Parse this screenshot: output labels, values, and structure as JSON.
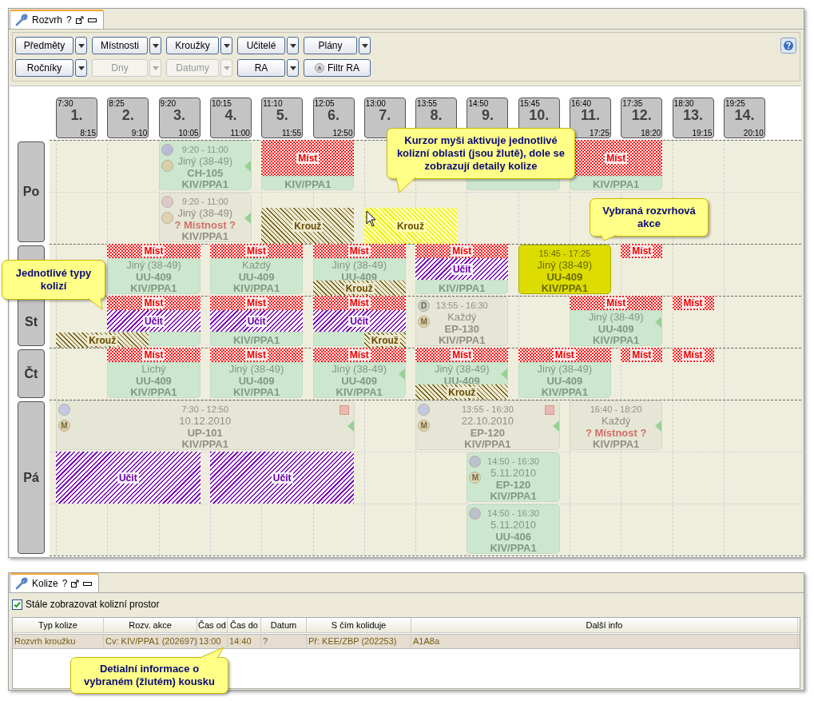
{
  "main_tab": {
    "title": "Rozvrh",
    "help": "?"
  },
  "toolbar": {
    "rows": [
      [
        {
          "label": "Předměty",
          "kind": "split",
          "disabled": false
        },
        {
          "label": "Místnosti",
          "kind": "split",
          "disabled": false
        },
        {
          "label": "Kroužky",
          "kind": "split",
          "disabled": false
        },
        {
          "label": "Učitelé",
          "kind": "split",
          "disabled": false
        },
        {
          "label": "Plány",
          "kind": "split",
          "disabled": false
        }
      ],
      [
        {
          "label": "Ročníky",
          "kind": "split",
          "disabled": false
        },
        {
          "label": "Dny",
          "kind": "split",
          "disabled": true
        },
        {
          "label": "Datumy",
          "kind": "split",
          "disabled": true
        },
        {
          "label": "RA",
          "kind": "split",
          "disabled": false
        },
        {
          "label": "Filtr RA",
          "kind": "button",
          "disabled": false
        }
      ]
    ]
  },
  "periods": [
    {
      "start": "7:30",
      "number": "1.",
      "end": "8:15"
    },
    {
      "start": "8:25",
      "number": "2.",
      "end": "9:10"
    },
    {
      "start": "9:20",
      "number": "3.",
      "end": "10:05"
    },
    {
      "start": "10:15",
      "number": "4.",
      "end": "11:00"
    },
    {
      "start": "11:10",
      "number": "5.",
      "end": "11:55"
    },
    {
      "start": "12:05",
      "number": "6.",
      "end": "12:50"
    },
    {
      "start": "13:00",
      "number": "7."
    },
    {
      "start": "13:55",
      "number": "8."
    },
    {
      "start": "14:50",
      "number": "9."
    },
    {
      "start": "15:45",
      "number": "10."
    },
    {
      "start": "16:40",
      "number": "11.",
      "end": "17:25"
    },
    {
      "start": "17:35",
      "number": "12.",
      "end": "18:20"
    },
    {
      "start": "18:30",
      "number": "13.",
      "end": "19:15"
    },
    {
      "start": "19:25",
      "number": "14.",
      "end": "20:10"
    }
  ],
  "days": [
    {
      "label": "Po",
      "lanes": [
        {
          "cards": [
            {
              "kind": "empty"
            },
            {
              "kind": "empty"
            },
            {
              "kind": "event",
              "selected": false,
              "inactive": false,
              "arrow": true,
              "flag": false,
              "badges": [
                {
                  "color": "#b8bcd8"
                },
                {
                  "color": "#d8d0a8"
                }
              ],
              "time": "9:20 - 11:00",
              "info": "Jiný (38-49)",
              "room": "CH-105",
              "course": "KIV/PPA1"
            },
            {
              "kind": "more"
            },
            {
              "kind": "event",
              "selected": false,
              "inactive": false,
              "arrow": false,
              "flag": false,
              "course": "KIV/PPA1"
            },
            {
              "kind": "more"
            },
            {
              "kind": "empty"
            },
            {
              "kind": "empty"
            },
            {
              "kind": "event",
              "selected": false,
              "inactive": false,
              "arrow": false,
              "flag": false
            },
            {
              "kind": "more"
            },
            {
              "kind": "event",
              "selected": false,
              "inactive": false,
              "arrow": false,
              "flag": false,
              "course": "KIV/PPA1"
            },
            {
              "kind": "more"
            }
          ],
          "upper": [
            {
              "kind": "empty"
            },
            {
              "kind": "empty"
            },
            {
              "kind": "empty"
            },
            {
              "kind": "empty"
            },
            {
              "kind": "mist",
              "label": "Míst",
              "active": false
            },
            {
              "kind": "more"
            },
            {
              "kind": "empty"
            },
            {
              "kind": "empty"
            },
            {
              "kind": "empty"
            },
            {
              "kind": "empty"
            },
            {
              "kind": "mist",
              "label": "Míst",
              "active": false
            },
            {
              "kind": "more"
            }
          ]
        },
        {
          "cards": [
            {
              "kind": "empty"
            },
            {
              "kind": "empty"
            },
            {
              "kind": "event",
              "selected": false,
              "inactive": true,
              "arrow": true,
              "flag": false,
              "badges": [
                {
                  "color": "#e0c8c8"
                },
                {
                  "color": "#e0d4b0"
                }
              ],
              "time": "9:20 - 11:00",
              "info": "Jiný (38-49)",
              "room": "? Místnost ?",
              "room_missing": true,
              "course": "KIV/PPA1"
            },
            {
              "kind": "more"
            }
          ],
          "lower": [
            {
              "kind": "empty"
            },
            {
              "kind": "empty"
            },
            {
              "kind": "empty"
            },
            {
              "kind": "empty"
            },
            {
              "kind": "krouz",
              "label": "Krouž",
              "active": false
            },
            {
              "kind": "more"
            },
            {
              "kind": "krouz",
              "label": "Krouž",
              "active": true
            },
            {
              "kind": "more"
            }
          ]
        }
      ]
    },
    {
      "lanes": [
        {
          "cards": [
            {
              "kind": "empty"
            },
            {
              "kind": "event",
              "selected": false,
              "inactive": false,
              "arrow": false,
              "flag": false,
              "info": "Jiný (38-49)",
              "room": "UU-409",
              "course": "KIV/PPA1"
            },
            {
              "kind": "more"
            },
            {
              "kind": "event",
              "selected": false,
              "inactive": false,
              "arrow": false,
              "flag": false,
              "info": "Každý",
              "room": "UU-409",
              "course": "KIV/PPA1"
            },
            {
              "kind": "more"
            },
            {
              "kind": "event",
              "selected": false,
              "inactive": false,
              "arrow": false,
              "flag": false,
              "info": "Jiný (38-49)",
              "room": "UU-409"
            },
            {
              "kind": "more"
            },
            {
              "kind": "event",
              "selected": false,
              "inactive": false,
              "arrow": false,
              "flag": false,
              "course": "KIV/PPA1"
            },
            {
              "kind": "more"
            },
            {
              "kind": "event",
              "selected": true,
              "inactive": false,
              "arrow": false,
              "flag": false,
              "time": "15:45 - 17:25",
              "info": "Jiný (38-49)",
              "room": "UU-409",
              "course": "KIV/PPA1"
            },
            {
              "kind": "more"
            }
          ],
          "top": [
            {
              "kind": "empty"
            },
            {
              "kind": "mist",
              "label": "Míst",
              "active": false
            },
            {
              "kind": "more"
            },
            {
              "kind": "mist",
              "label": "Míst",
              "active": false
            },
            {
              "kind": "more"
            },
            {
              "kind": "mist",
              "label": "Míst",
              "active": false
            },
            {
              "kind": "more"
            },
            {
              "kind": "mist",
              "label": "Míst",
              "active": false
            },
            {
              "kind": "more"
            },
            {
              "kind": "empty"
            },
            {
              "kind": "empty"
            },
            {
              "kind": "mist",
              "label": "Míst",
              "active": false
            }
          ],
          "middle": [
            {
              "kind": "empty"
            },
            {
              "kind": "empty"
            },
            {
              "kind": "empty"
            },
            {
              "kind": "empty"
            },
            {
              "kind": "empty"
            },
            {
              "kind": "empty"
            },
            {
              "kind": "empty"
            },
            {
              "kind": "ucit",
              "label": "Učit",
              "active": false
            },
            {
              "kind": "more"
            }
          ],
          "bottom": [
            {
              "kind": "empty"
            },
            {
              "kind": "empty"
            },
            {
              "kind": "empty"
            },
            {
              "kind": "empty"
            },
            {
              "kind": "empty"
            },
            {
              "kind": "krouz",
              "label": "Krouž",
              "active": false
            },
            {
              "kind": "more"
            }
          ]
        }
      ]
    },
    {
      "label": "St",
      "lanes": [
        {
          "cards": [
            {
              "kind": "empty"
            },
            {
              "kind": "event",
              "selected": false,
              "inactive": false,
              "arrow": false,
              "flag": false
            },
            {
              "kind": "more"
            },
            {
              "kind": "event",
              "selected": false,
              "inactive": false,
              "arrow": false,
              "flag": false,
              "course": "KIV/PPA1"
            },
            {
              "kind": "more"
            },
            {
              "kind": "event",
              "selected": false,
              "inactive": false,
              "arrow": false,
              "flag": false
            },
            {
              "kind": "more"
            },
            {
              "kind": "event",
              "selected": false,
              "inactive": true,
              "arrow": false,
              "flag": false,
              "badges": [
                {
                  "color": "#c8d0c0",
                  "text": "D"
                },
                {
                  "color": "#e8d0a0",
                  "text": "M"
                }
              ],
              "time": "13:55 - 16:30",
              "info": "Každý",
              "room": "EP-130",
              "course": "KIV/PPA1"
            },
            {
              "kind": "more"
            },
            {
              "kind": "empty"
            },
            {
              "kind": "event",
              "selected": false,
              "inactive": false,
              "arrow": true,
              "flag": false,
              "info": "Jiný (38-49)",
              "room": "UU-409",
              "course": "KIV/PPA1"
            },
            {
              "kind": "more"
            }
          ],
          "top": [
            {
              "kind": "empty"
            },
            {
              "kind": "mist",
              "label": "Míst",
              "active": false
            },
            {
              "kind": "more"
            },
            {
              "kind": "mist",
              "label": "Míst",
              "active": false
            },
            {
              "kind": "more"
            },
            {
              "kind": "mist",
              "label": "Míst",
              "active": false
            },
            {
              "kind": "more"
            },
            {
              "kind": "empty"
            },
            {
              "kind": "empty"
            },
            {
              "kind": "empty"
            },
            {
              "kind": "mist",
              "label": "Míst",
              "active": false
            },
            {
              "kind": "more"
            },
            {
              "kind": "mist",
              "label": "Míst",
              "active": false
            }
          ],
          "middle": [
            {
              "kind": "empty"
            },
            {
              "kind": "ucit",
              "label": "Učit",
              "active": false
            },
            {
              "kind": "more"
            },
            {
              "kind": "ucit",
              "label": "Učit",
              "active": false
            },
            {
              "kind": "more"
            },
            {
              "kind": "ucit",
              "label": "Učit",
              "active": false
            },
            {
              "kind": "more"
            }
          ],
          "bottom": [
            {
              "kind": "krouz",
              "label": "Krouž",
              "active": false
            },
            {
              "kind": "more"
            },
            {
              "kind": "empty"
            },
            {
              "kind": "empty"
            },
            {
              "kind": "empty"
            },
            {
              "kind": "empty"
            },
            {
              "kind": "krouz",
              "label": "Krouž",
              "active": false
            }
          ]
        }
      ]
    },
    {
      "label": "Čt",
      "lanes": [
        {
          "cards": [
            {
              "kind": "empty"
            },
            {
              "kind": "event",
              "selected": false,
              "inactive": false,
              "arrow": false,
              "flag": false,
              "info": "Lichý",
              "room": "UU-409",
              "course": "KIV/PPA1"
            },
            {
              "kind": "more"
            },
            {
              "kind": "event",
              "selected": false,
              "inactive": false,
              "arrow": false,
              "flag": false,
              "info": "Jiný (38-49)",
              "room": "UU-409",
              "course": "KIV/PPA1"
            },
            {
              "kind": "more"
            },
            {
              "kind": "event",
              "selected": false,
              "inactive": false,
              "arrow": true,
              "flag": false,
              "info": "Jiný (38-49)",
              "room": "UU-409",
              "course": "KIV/PPA1"
            },
            {
              "kind": "more"
            },
            {
              "kind": "event",
              "selected": false,
              "inactive": false,
              "arrow": true,
              "flag": false,
              "info": "Jiný (38-49)",
              "room": "UU-409"
            },
            {
              "kind": "more"
            },
            {
              "kind": "event",
              "selected": false,
              "inactive": false,
              "arrow": false,
              "flag": false,
              "info": "Jiný (38-49)",
              "room": "UU-409",
              "course": "KIV/PPA1"
            },
            {
              "kind": "more"
            }
          ],
          "top": [
            {
              "kind": "empty"
            },
            {
              "kind": "mist",
              "label": "Míst",
              "active": false
            },
            {
              "kind": "more"
            },
            {
              "kind": "mist",
              "label": "Míst",
              "active": false
            },
            {
              "kind": "more"
            },
            {
              "kind": "mist",
              "label": "Míst",
              "active": false
            },
            {
              "kind": "more"
            },
            {
              "kind": "mist",
              "label": "Míst",
              "active": false
            },
            {
              "kind": "more"
            },
            {
              "kind": "mist",
              "label": "Míst",
              "active": false
            },
            {
              "kind": "more"
            },
            {
              "kind": "mist",
              "label": "Míst",
              "active": false
            },
            {
              "kind": "mist",
              "label": "Míst",
              "active": false
            }
          ],
          "bottom": [
            {
              "kind": "empty"
            },
            {
              "kind": "empty"
            },
            {
              "kind": "empty"
            },
            {
              "kind": "empty"
            },
            {
              "kind": "empty"
            },
            {
              "kind": "empty"
            },
            {
              "kind": "empty"
            },
            {
              "kind": "krouz",
              "label": "Krouž",
              "active": false
            },
            {
              "kind": "more"
            }
          ]
        }
      ]
    },
    {
      "label": "Pá",
      "lanes": [
        {
          "cards": [
            {
              "kind": "event",
              "selected": false,
              "inactive": true,
              "arrow": true,
              "flag": true,
              "badges": [
                {
                  "color": "#c4c8e4"
                },
                {
                  "color": "#e8d0a0",
                  "text": "M"
                }
              ],
              "time": "7:30 - 12:50",
              "info": "10.12.2010",
              "room": "UP-101",
              "course": "KIV/PPA1"
            },
            {
              "kind": "more"
            },
            {
              "kind": "more"
            },
            {
              "kind": "more"
            },
            {
              "kind": "more"
            },
            {
              "kind": "more"
            },
            {
              "kind": "empty"
            },
            {
              "kind": "event",
              "selected": false,
              "inactive": true,
              "arrow": true,
              "flag": true,
              "badges": [
                {
                  "color": "#c4c8e4"
                },
                {
                  "color": "#e8d0a0",
                  "text": "M"
                }
              ],
              "time": "13:55 - 16:30",
              "info": "22.10.2010",
              "room": "EP-120",
              "course": "KIV/PPA1"
            },
            {
              "kind": "more"
            },
            {
              "kind": "more"
            },
            {
              "kind": "event",
              "selected": false,
              "inactive": true,
              "arrow": true,
              "flag": false,
              "time": "16:40 - 18:20",
              "info": "Každý",
              "room": "? Místnost ?",
              "room_missing": true,
              "course": "KIV/PPA1"
            },
            {
              "kind": "more"
            }
          ]
        },
        {
          "cards": [
            {
              "kind": "empty"
            },
            {
              "kind": "empty"
            },
            {
              "kind": "empty"
            },
            {
              "kind": "empty"
            },
            {
              "kind": "empty"
            },
            {
              "kind": "empty"
            },
            {
              "kind": "empty"
            },
            {
              "kind": "empty"
            },
            {
              "kind": "event",
              "selected": false,
              "inactive": false,
              "arrow": false,
              "flag": false,
              "badges": [
                {
                  "color": "#bcc0cc"
                },
                {
                  "color": "#e0d8a8",
                  "text": "M"
                }
              ],
              "time": "14:50 - 16:30",
              "info": "5.11.2010",
              "room": "EP-120",
              "course": "KIV/PPA1"
            },
            {
              "kind": "more"
            }
          ],
          "full": [
            {
              "kind": "ucit",
              "label": "Učit",
              "active": false
            },
            {
              "kind": "more"
            },
            {
              "kind": "more"
            },
            {
              "kind": "ucit",
              "label": "Učit",
              "active": false
            },
            {
              "kind": "more"
            },
            {
              "kind": "more"
            }
          ]
        },
        {
          "cards": [
            {
              "kind": "empty"
            },
            {
              "kind": "empty"
            },
            {
              "kind": "empty"
            },
            {
              "kind": "empty"
            },
            {
              "kind": "empty"
            },
            {
              "kind": "empty"
            },
            {
              "kind": "empty"
            },
            {
              "kind": "empty"
            },
            {
              "kind": "event",
              "selected": false,
              "inactive": false,
              "arrow": false,
              "flag": false,
              "badges": [
                {
                  "color": "#bcc0cc"
                }
              ],
              "time": "14:50 - 16:30",
              "info": "5.11.2010",
              "room": "UU-406",
              "course": "KIV/PPA1"
            },
            {
              "kind": "more"
            }
          ]
        }
      ]
    }
  ],
  "callouts": [
    "Kurzor myši aktivuje jednotlivé kolizní oblasti (jsou žlutě), dole se zobrazují detaily kolize",
    "Vybraná rozvrhová akce",
    "Jednotlivé typy kolizí",
    "Detialní informace o vybraném (žlutém) kousku"
  ],
  "collision_tab": {
    "title": "Kolize",
    "help": "?"
  },
  "always_show": {
    "label": "Stále zobrazovat kolizní prostor",
    "checked": true
  },
  "table": {
    "columns": [
      "Typ kolize",
      "Rozv. akce",
      "Čas od",
      "Čas do",
      "Datum",
      "S čím koliduje",
      "Další info"
    ],
    "rows": [
      {
        "selected": true,
        "cells": [
          "Rozvrh kroužku",
          "Cv: KIV/PPA1 (202697)",
          "13:00",
          "14:40",
          "?",
          "Př: KEE/ZBP (202253)",
          "A1A8a"
        ]
      }
    ]
  }
}
